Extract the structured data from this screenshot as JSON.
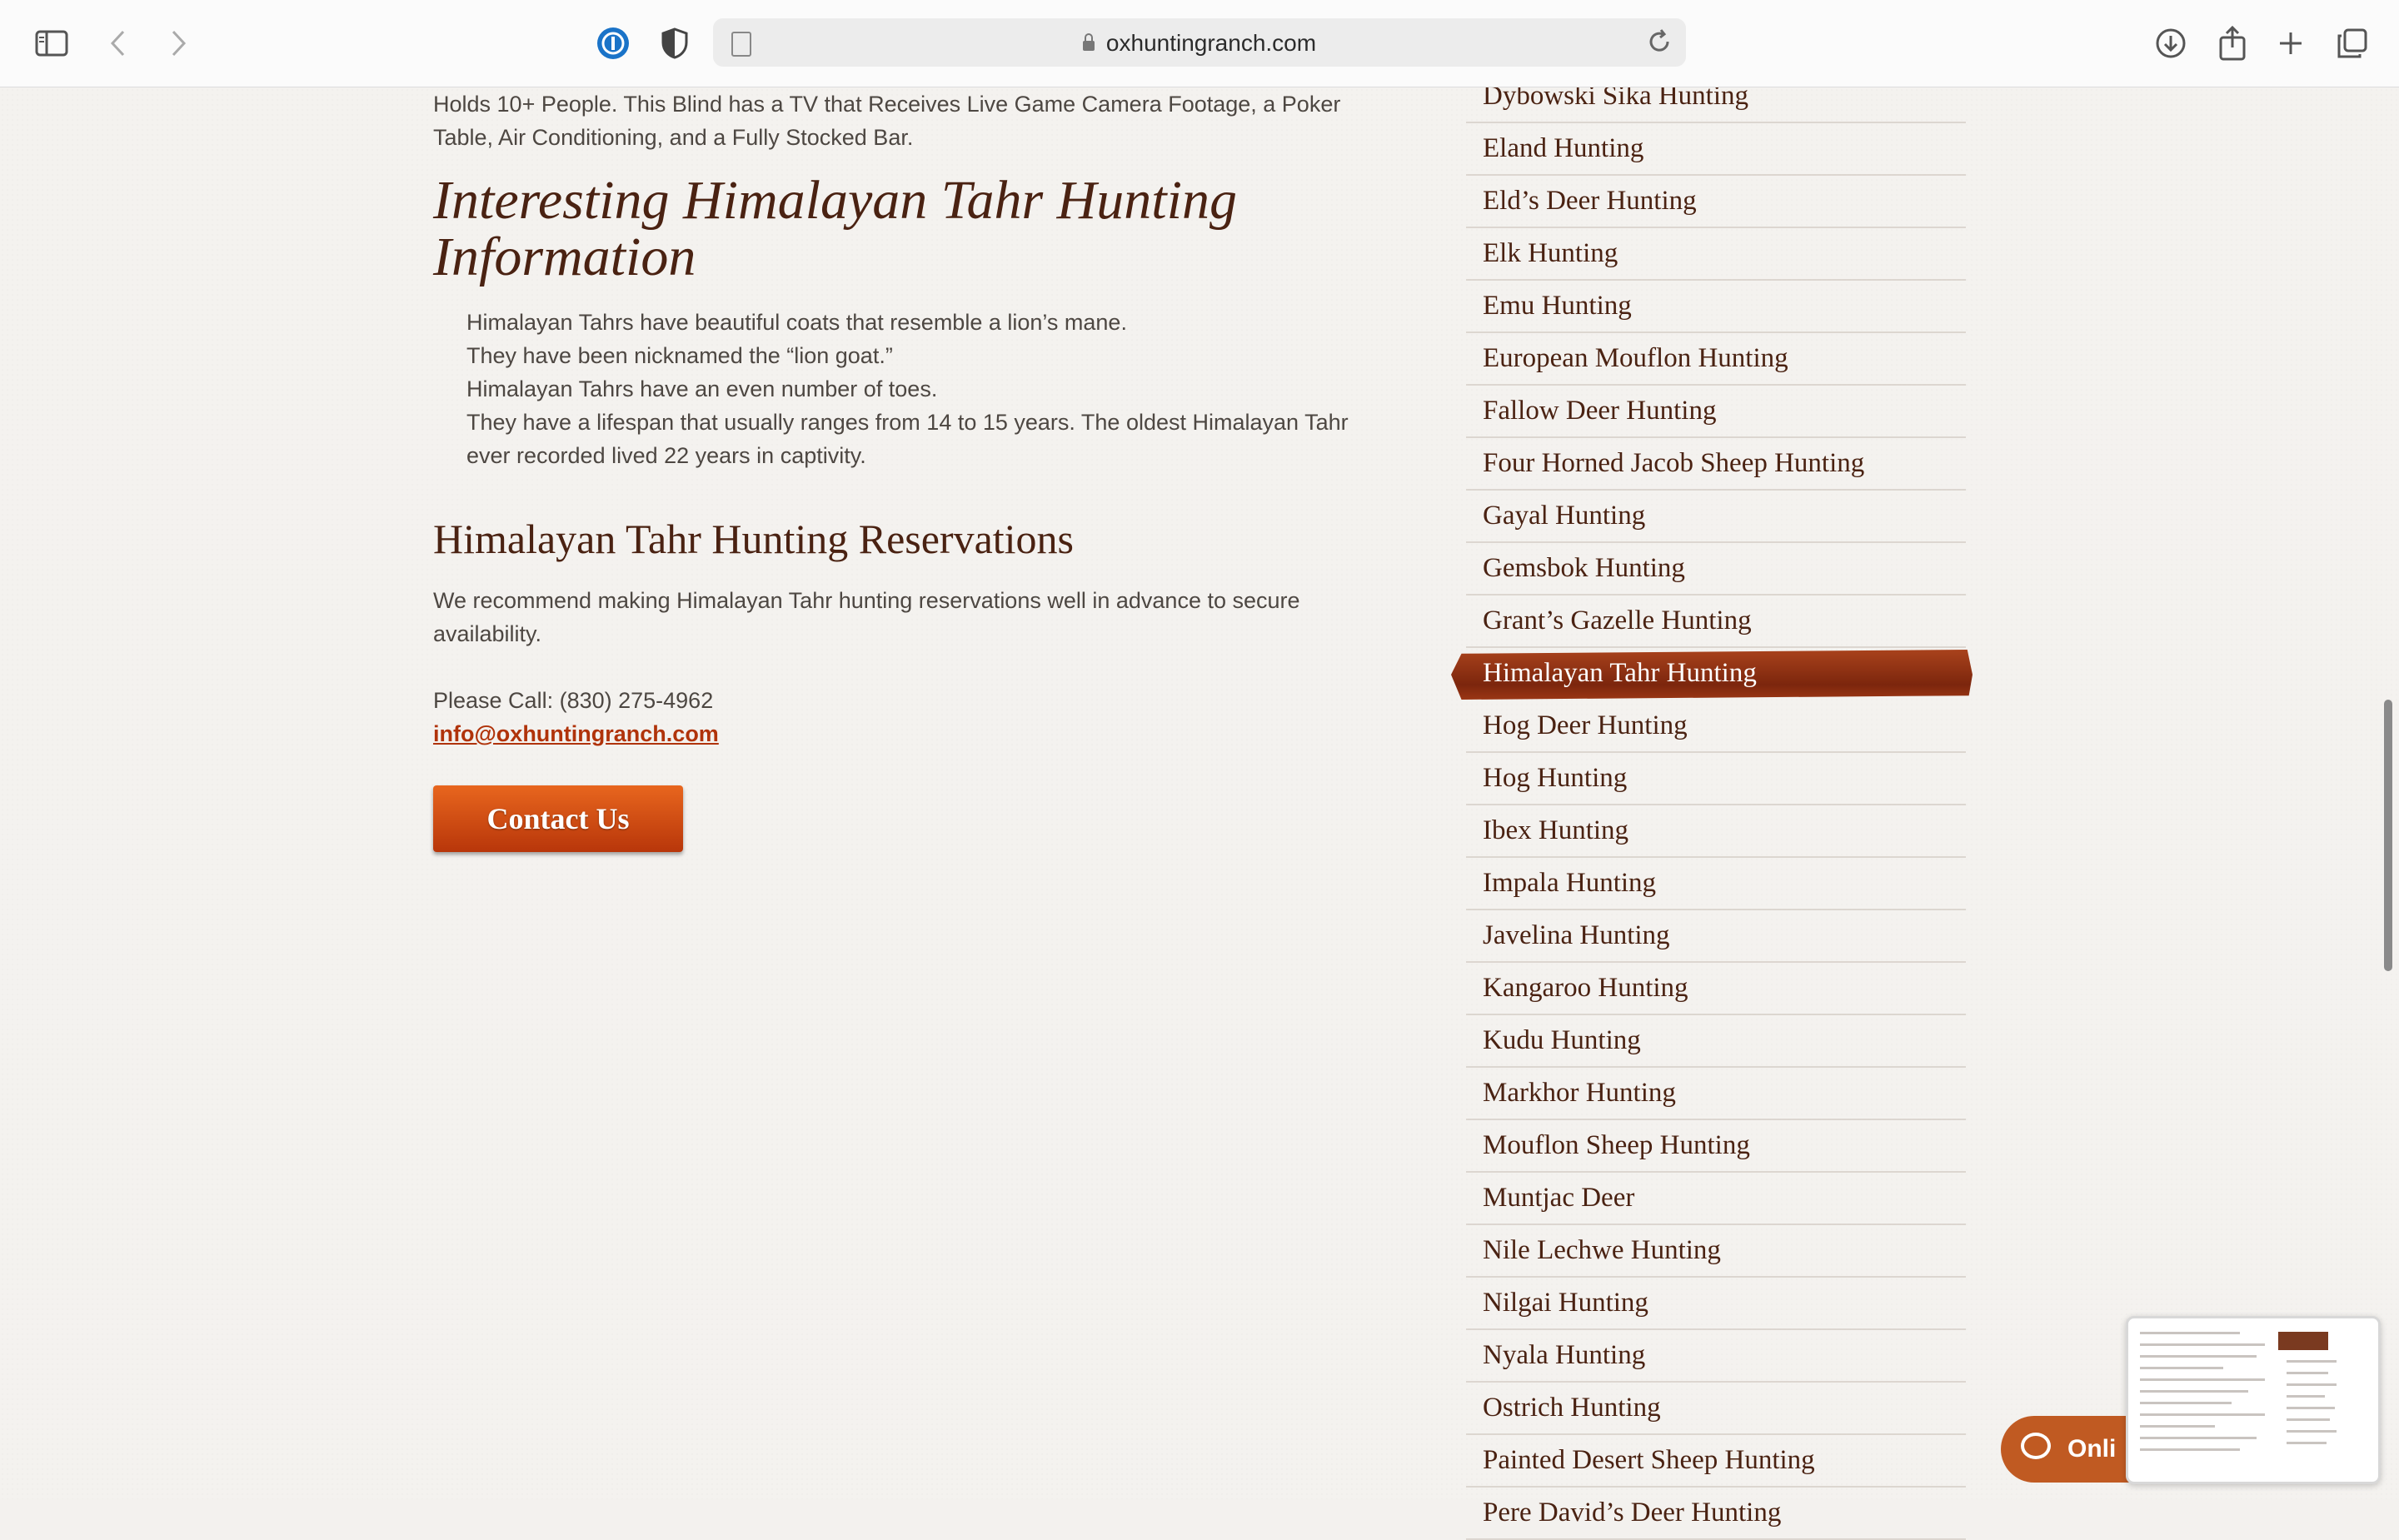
{
  "browser": {
    "url": "oxhuntingranch.com"
  },
  "content": {
    "intro_line1": "Holds 10+ People.  This Blind has a TV that Receives Live Game Camera Footage, a Poker",
    "intro_line2": "Table, Air Conditioning, and a Fully Stocked Bar.",
    "info_heading_line1": "Interesting Himalayan Tahr Hunting",
    "info_heading_line2": "Information",
    "facts": [
      "Himalayan Tahrs have beautiful coats that resemble a lion’s mane.",
      "They have been nicknamed the “lion goat.”",
      "Himalayan Tahrs have an even number of toes.",
      "They have a lifespan that usually ranges from 14 to 15 years. The oldest Himalayan Tahr",
      "ever recorded lived 22 years in captivity."
    ],
    "reservations_heading": "Himalayan Tahr Hunting Reservations",
    "reservations_line1": "We recommend making Himalayan Tahr hunting reservations well in advance to secure",
    "reservations_line2": "availability.",
    "phone_text": "Please Call: (830) 275-4962",
    "email": "info@oxhuntingranch.com",
    "contact_button": "Contact Us"
  },
  "menu": {
    "items": [
      "Dybowski Sika Hunting",
      "Eland Hunting",
      "Eld’s Deer Hunting",
      "Elk Hunting",
      "Emu Hunting",
      "European Mouflon Hunting",
      "Fallow Deer Hunting",
      "Four Horned Jacob Sheep Hunting",
      "Gayal Hunting",
      "Gemsbok Hunting",
      "Grant’s Gazelle Hunting",
      "Himalayan Tahr Hunting",
      "Hog Deer Hunting",
      "Hog Hunting",
      "Ibex Hunting",
      "Impala Hunting",
      "Javelina Hunting",
      "Kangaroo Hunting",
      "Kudu Hunting",
      "Markhor Hunting",
      "Mouflon Sheep Hunting",
      "Muntjac Deer",
      "Nile Lechwe Hunting",
      "Nilgai Hunting",
      "Nyala Hunting",
      "Ostrich Hunting",
      "Painted Desert Sheep Hunting",
      "Pere David’s Deer Hunting"
    ],
    "active": "Himalayan Tahr Hunting"
  },
  "chat": {
    "label": "Onli"
  },
  "colors": {
    "heading": "#4a2212",
    "accent": "#c6501a",
    "link": "#b0330a"
  }
}
